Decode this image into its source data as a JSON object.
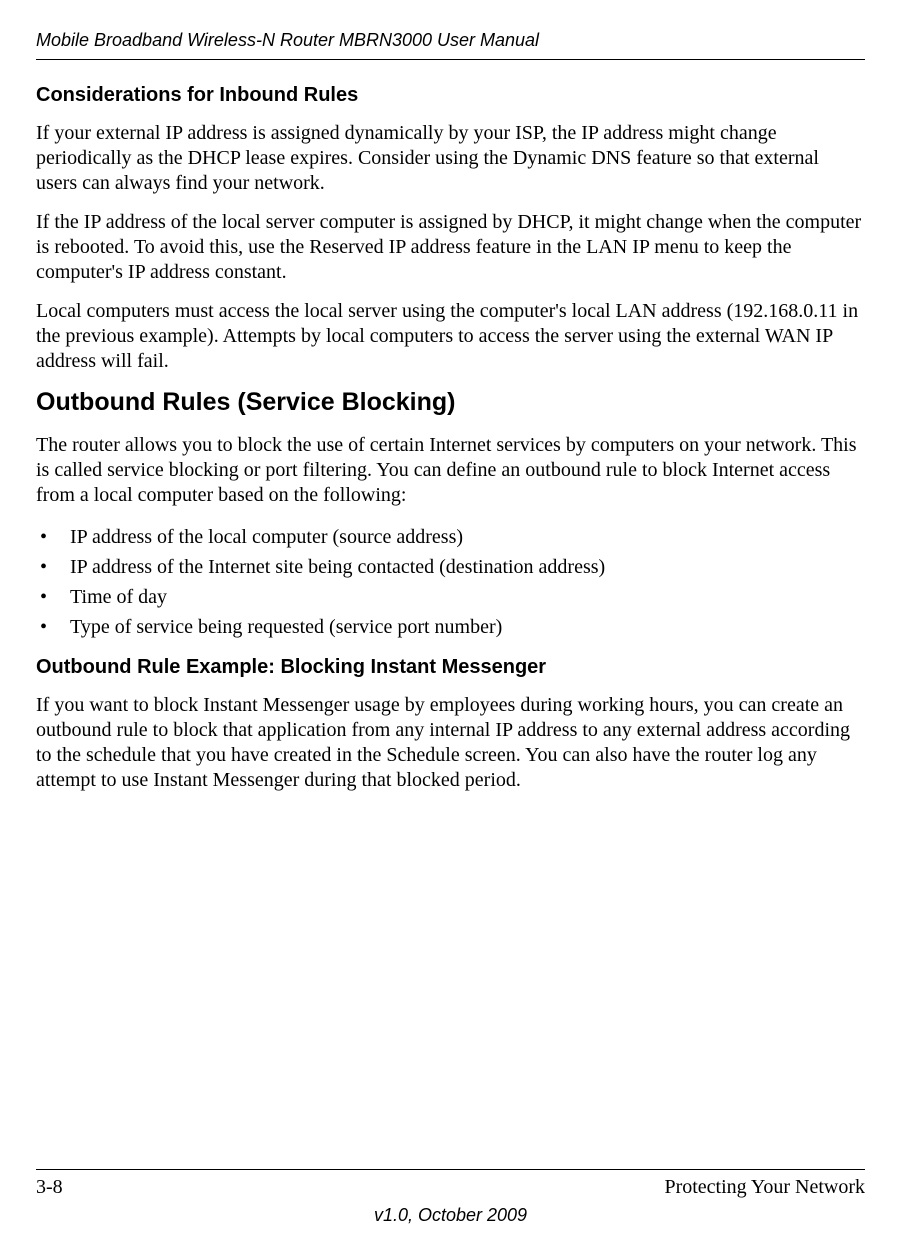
{
  "header": {
    "title": "Mobile Broadband Wireless-N Router MBRN3000 User Manual"
  },
  "section1": {
    "heading": "Considerations for Inbound Rules",
    "p1": "If your external IP address is assigned dynamically by your ISP, the IP address might change periodically as the DHCP lease expires. Consider using the Dynamic DNS feature so that external users can always find your network.",
    "p2": "If the IP address of the local server computer is assigned by DHCP, it might change when the computer is rebooted. To avoid this, use the Reserved IP address feature in the LAN IP menu to keep the computer's IP address constant.",
    "p3": "Local computers must access the local server using the computer's local LAN address (192.168.0.11 in the previous example). Attempts by local computers to access the server using the external WAN IP address will fail."
  },
  "section2": {
    "heading": "Outbound Rules (Service Blocking)",
    "p1": "The router allows you to block the use of certain Internet services by computers on your network. This is called service blocking or port filtering. You can define an outbound rule to block Internet access from a local computer based on the following:",
    "bullets": [
      "IP address of the local computer (source address)",
      "IP address of the Internet site being contacted (destination address)",
      "Time of day",
      "Type of service being requested (service port number)"
    ]
  },
  "section3": {
    "heading": "Outbound Rule Example: Blocking Instant Messenger",
    "p1": "If you want to block Instant Messenger usage by employees during working hours, you can create an outbound rule to block that application from any internal IP address to any external address according to the schedule that you have created in the Schedule screen. You can also have the router log any attempt to use Instant Messenger during that blocked period."
  },
  "footer": {
    "page": "3-8",
    "chapter": "Protecting Your Network",
    "version": "v1.0, October 2009"
  }
}
